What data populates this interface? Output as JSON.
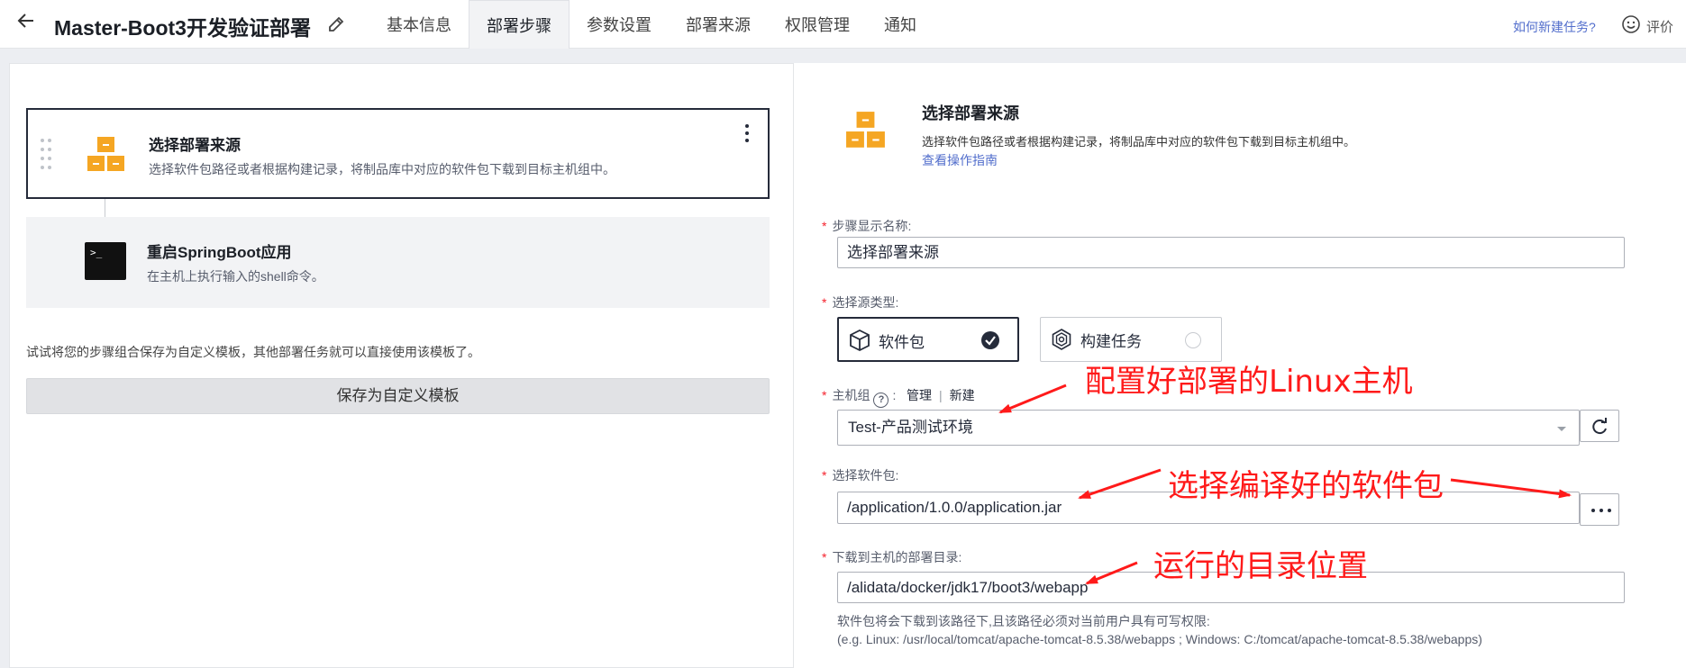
{
  "header": {
    "title": "Master-Boot3开发验证部署",
    "tabs": [
      "基本信息",
      "部署步骤",
      "参数设置",
      "部署来源",
      "权限管理",
      "通知"
    ],
    "active_tab": "部署步骤",
    "help_link": "如何新建任务?",
    "rate_label": "评价"
  },
  "steps": [
    {
      "title": "选择部署来源",
      "desc": "选择软件包路径或者根据构建记录，将制品库中对应的软件包下载到目标主机组中。",
      "icon": "package-boxes-icon"
    },
    {
      "title": "重启SpringBoot应用",
      "desc": "在主机上执行输入的shell命令。",
      "icon": "terminal-icon"
    }
  ],
  "left_footer": {
    "hint": "试试将您的步骤组合保存为自定义模板，其他部署任务就可以直接使用该模板了。",
    "save_button": "保存为自定义模板"
  },
  "detail": {
    "title": "选择部署来源",
    "desc": "选择软件包路径或者根据构建记录，将制品库中对应的软件包下载到目标主机组中。",
    "guide_link": "查看操作指南",
    "step_name_label": "步骤显示名称:",
    "step_name_value": "选择部署来源",
    "source_type_label": "选择源类型:",
    "source_types": [
      {
        "label": "软件包",
        "selected": true
      },
      {
        "label": "构建任务",
        "selected": false
      }
    ],
    "host_group_label": "主机组",
    "host_group_colon": ":",
    "host_group_manage": "管理",
    "host_group_sep": "|",
    "host_group_new": "新建",
    "host_group_value": "Test-产品测试环境",
    "package_label": "选择软件包:",
    "package_value": "/application/1.0.0/application.jar",
    "deploy_dir_label": "下载到主机的部署目录:",
    "deploy_dir_value": "/alidata/docker/jdk17/boot3/webapp",
    "path_help_1": "软件包将会下载到该路径下,且该路径必须对当前用户具有可写权限:",
    "path_help_2": "(e.g. Linux: /usr/local/tomcat/apache-tomcat-8.5.38/webapps ; Windows: C:/tomcat/apache-tomcat-8.5.38/webapps)"
  },
  "annotations": {
    "host": "配置好部署的Linux主机",
    "package": "选择编译好的软件包",
    "dir": "运行的目录位置",
    "color": "#ff1a1a"
  }
}
